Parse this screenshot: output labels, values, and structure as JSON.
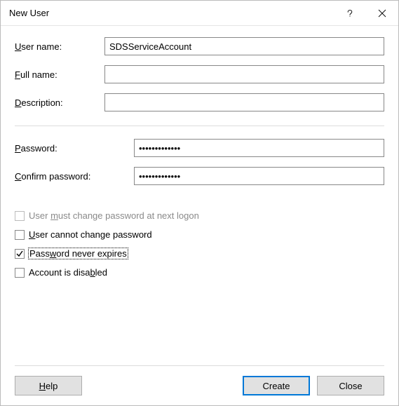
{
  "window": {
    "title": "New User"
  },
  "fields": {
    "username_label_pre": "",
    "username_label": "User name:",
    "username_u": "U",
    "username_rest": "ser name:",
    "username_value": "SDSServiceAccount",
    "fullname_u": "F",
    "fullname_rest": "ull name:",
    "fullname_value": "",
    "description_u": "D",
    "description_rest": "escription:",
    "description_value": "",
    "password_u": "P",
    "password_rest": "assword:",
    "password_value": "•••••••••••••",
    "confirm_u": "C",
    "confirm_rest": "onfirm password:",
    "confirm_value": "•••••••••••••"
  },
  "checks": {
    "must_change_pre": "User ",
    "must_change_u": "m",
    "must_change_post": "ust change password at next logon",
    "must_change_checked": false,
    "must_change_enabled": false,
    "cannot_change_pre": "",
    "cannot_change_u": "U",
    "cannot_change_post": "ser cannot change password",
    "cannot_change_checked": false,
    "never_expires_pre": "Pass",
    "never_expires_u": "w",
    "never_expires_post": "ord never expires",
    "never_expires_checked": true,
    "disabled_pre": "Account is disa",
    "disabled_u": "b",
    "disabled_post": "led",
    "disabled_checked": false
  },
  "buttons": {
    "help_u": "H",
    "help_rest": "elp",
    "create": "Create",
    "close": "Close"
  }
}
